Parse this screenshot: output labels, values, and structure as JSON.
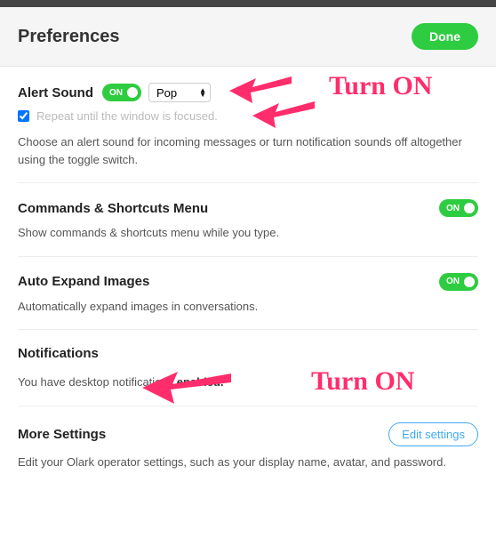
{
  "header": {
    "title": "Preferences",
    "done_label": "Done"
  },
  "alert_sound": {
    "title": "Alert Sound",
    "toggle_label": "ON",
    "select_value": "Pop",
    "repeat_label": "Repeat until the window is focused.",
    "repeat_checked": true,
    "desc": "Choose an alert sound for incoming messages or turn notification sounds off altogether using the toggle switch."
  },
  "commands": {
    "title": "Commands & Shortcuts Menu",
    "toggle_label": "ON",
    "desc": "Show commands & shortcuts menu while you type."
  },
  "auto_expand": {
    "title": "Auto Expand Images",
    "toggle_label": "ON",
    "desc": "Automatically expand images in conversations."
  },
  "notifications": {
    "title": "Notifications",
    "desc_prefix": "You have desktop notifications ",
    "desc_status": "enabled."
  },
  "more_settings": {
    "title": "More Settings",
    "button_label": "Edit settings",
    "desc": "Edit your Olark operator settings, such as your display name, avatar, and password."
  },
  "annotations": {
    "turn_on_1": "Turn ON",
    "turn_on_2": "Turn ON"
  }
}
